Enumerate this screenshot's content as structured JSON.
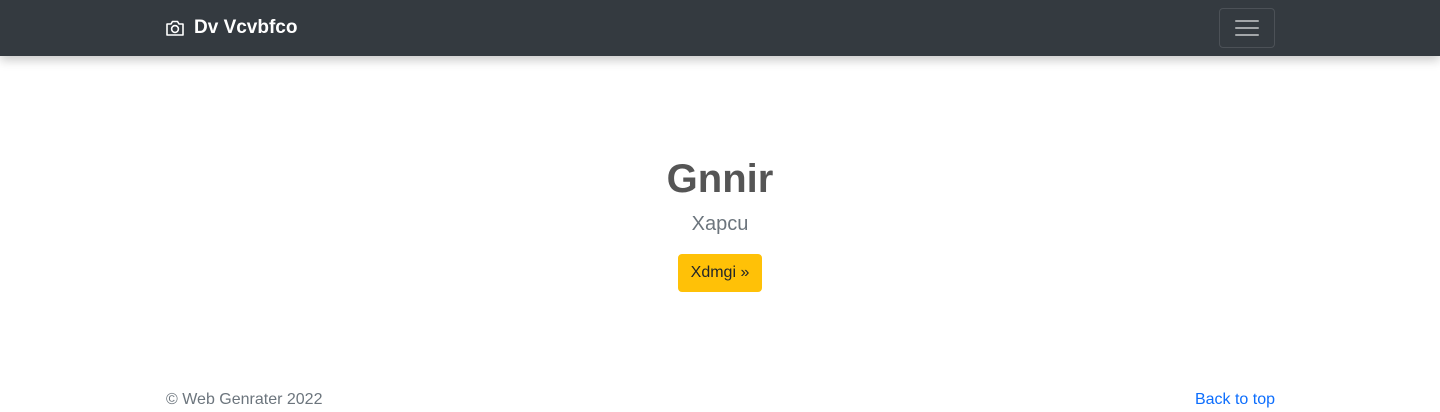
{
  "navbar": {
    "brand_label": "Dv Vcvbfco",
    "brand_icon": "camera-icon",
    "toggler_icon": "hamburger-menu-icon"
  },
  "hero": {
    "title": "Gnnir",
    "subtitle": "Xapcu",
    "button_label": "Xdmgi »"
  },
  "footer": {
    "copyright": "© Web Genrater 2022",
    "back_to_top": "Back to top"
  },
  "colors": {
    "navbar_bg": "#343a40",
    "button_bg": "#ffc107",
    "link": "#0d6efd"
  }
}
